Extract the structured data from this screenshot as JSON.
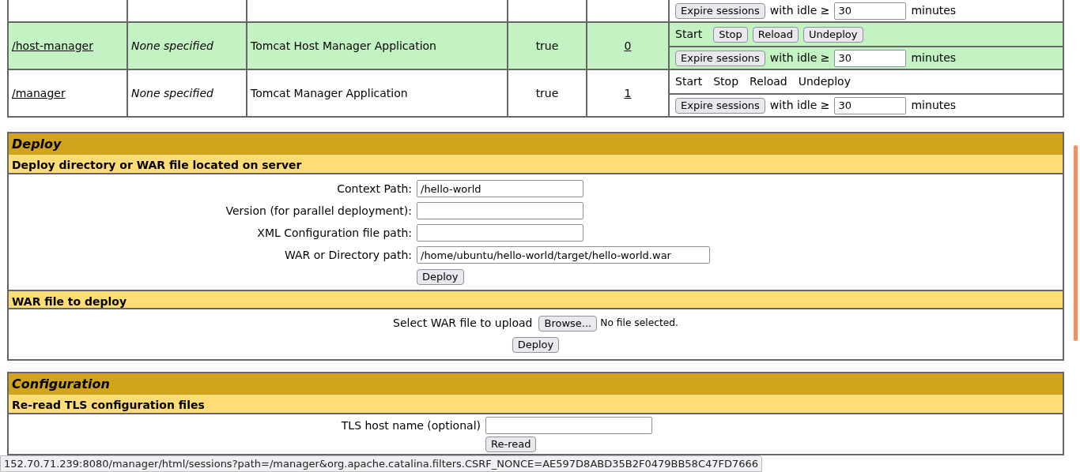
{
  "apps": [
    {
      "highlighted": false,
      "expire": {
        "button": "Expire sessions",
        "label": "with idle ≥",
        "value": "30",
        "unit": "minutes"
      }
    },
    {
      "path": "/host-manager",
      "version": "None specified",
      "display_name": "Tomcat Host Manager Application",
      "running": "true",
      "sessions": "0",
      "highlighted": true,
      "commands": [
        {
          "label": "Start",
          "kind": "text"
        },
        {
          "label": "Stop",
          "kind": "button"
        },
        {
          "label": "Reload",
          "kind": "button"
        },
        {
          "label": "Undeploy",
          "kind": "button"
        }
      ],
      "expire": {
        "button": "Expire sessions",
        "label": "with idle ≥",
        "value": "30",
        "unit": "minutes"
      }
    },
    {
      "path": "/manager",
      "version": "None specified",
      "display_name": "Tomcat Manager Application",
      "running": "true",
      "sessions": "1",
      "highlighted": false,
      "commands": [
        {
          "label": "Start",
          "kind": "text"
        },
        {
          "label": "Stop",
          "kind": "text"
        },
        {
          "label": "Reload",
          "kind": "text"
        },
        {
          "label": "Undeploy",
          "kind": "text"
        }
      ],
      "expire": {
        "button": "Expire sessions",
        "label": "with idle ≥",
        "value": "30",
        "unit": "minutes"
      }
    }
  ],
  "sections": [
    {
      "title": "Deploy",
      "subsections": [
        {
          "title": "Deploy directory or WAR file located on server",
          "kind": "form",
          "fields": [
            {
              "label": "Context Path:",
              "value": "/hello-world",
              "wide": false
            },
            {
              "label": "Version (for parallel deployment):",
              "wide": false
            },
            {
              "label": "XML Configuration file path:",
              "wide": false
            },
            {
              "label": "WAR or Directory path:",
              "value": "/home/ubuntu/hello-world/target/hello-world.war",
              "wide": true
            }
          ],
          "button": "Deploy"
        },
        {
          "title": "WAR file to deploy",
          "kind": "upload",
          "label": "Select WAR file to upload",
          "browse": "Browse...",
          "file_status": "No file selected.",
          "button": "Deploy"
        }
      ]
    },
    {
      "title": "Configuration",
      "subsections": [
        {
          "title": "Re-read TLS configuration files",
          "kind": "form",
          "fields": [
            {
              "label": "TLS host name (optional)",
              "wide": false
            }
          ],
          "button": "Re-read"
        }
      ]
    }
  ],
  "status_bar": "152.70.71.239:8080/manager/html/sessions?path=/manager&org.apache.catalina.filters.CSRF_NONCE=AE597D8ABD35B2F0479BB58C47FD7666"
}
